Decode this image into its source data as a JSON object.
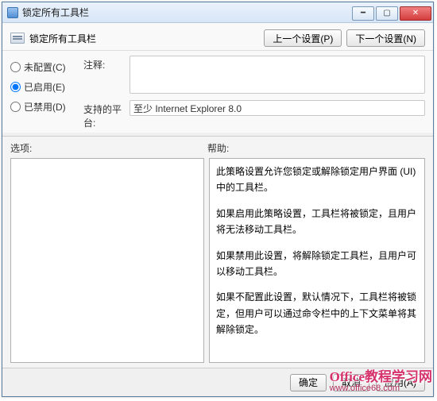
{
  "window": {
    "title": "锁定所有工具栏"
  },
  "header": {
    "policy_title": "锁定所有工具栏",
    "prev_btn": "上一个设置(P)",
    "next_btn": "下一个设置(N)"
  },
  "radios": {
    "not_configured": "未配置(C)",
    "enabled": "已启用(E)",
    "disabled": "已禁用(D)",
    "selected": "enabled"
  },
  "comment": {
    "label": "注释:",
    "value": ""
  },
  "platform": {
    "label": "支持的平台:",
    "value": "至少 Internet Explorer 8.0"
  },
  "body": {
    "options_label": "选项:",
    "help_label": "帮助:"
  },
  "help_text": {
    "p1": "此策略设置允许您锁定或解除锁定用户界面 (UI) 中的工具栏。",
    "p2": "如果启用此策略设置，工具栏将被锁定，且用户将无法移动工具栏。",
    "p3": "如果禁用此设置，将解除锁定工具栏，且用户可以移动工具栏。",
    "p4": "如果不配置此设置，默认情况下，工具栏将被锁定，但用户可以通过命令栏中的上下文菜单将其解除锁定。"
  },
  "footer": {
    "ok": "确定",
    "cancel": "取消",
    "apply": "应用(A)"
  },
  "watermark": {
    "line1": "Office教程学习网",
    "line2": "www.office68.com"
  }
}
